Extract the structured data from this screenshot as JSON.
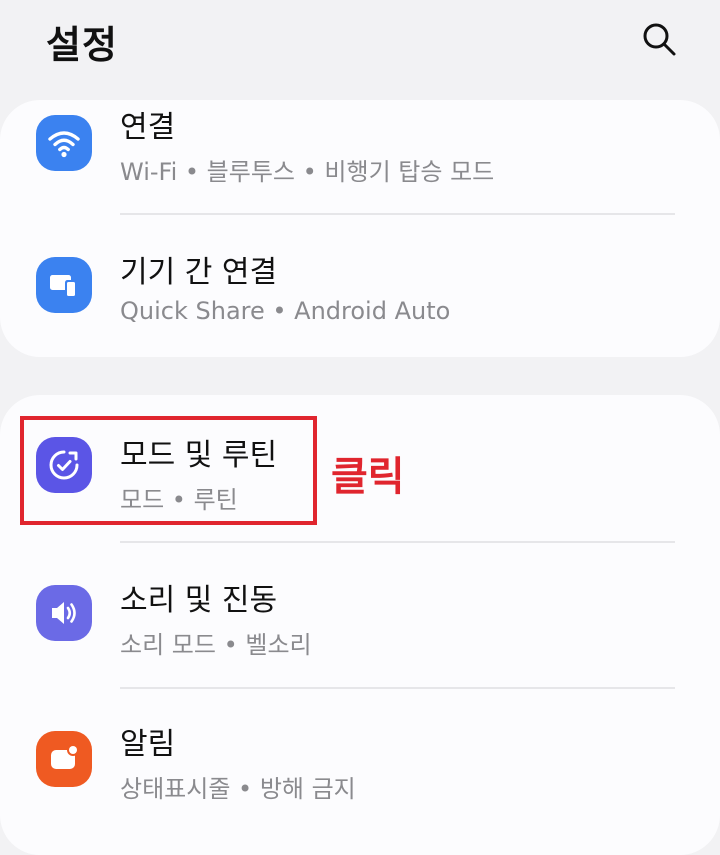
{
  "header": {
    "title": "설정",
    "search_icon": "search-icon"
  },
  "groups": [
    {
      "items": [
        {
          "title": "연결",
          "subtitle": "Wi-Fi • 블루투스 • 비행기 탑승 모드",
          "icon": "wifi-icon",
          "icon_color": "#3b82f0"
        },
        {
          "title": "기기 간 연결",
          "subtitle": "Quick Share • Android Auto",
          "icon": "devices-icon",
          "icon_color": "#3b82f0"
        }
      ]
    },
    {
      "items": [
        {
          "title": "모드 및 루틴",
          "subtitle": "모드 • 루틴",
          "icon": "modes-routines-icon",
          "icon_color": "#5b55e6"
        },
        {
          "title": "소리 및 진동",
          "subtitle": "소리 모드 • 벨소리",
          "icon": "speaker-icon",
          "icon_color": "#6b6ae6"
        },
        {
          "title": "알림",
          "subtitle": "상태표시줄 • 방해 금지",
          "icon": "notification-icon",
          "icon_color": "#ef5a22"
        }
      ]
    }
  ],
  "annotation": {
    "label": "클릭",
    "color": "#e0252e"
  }
}
